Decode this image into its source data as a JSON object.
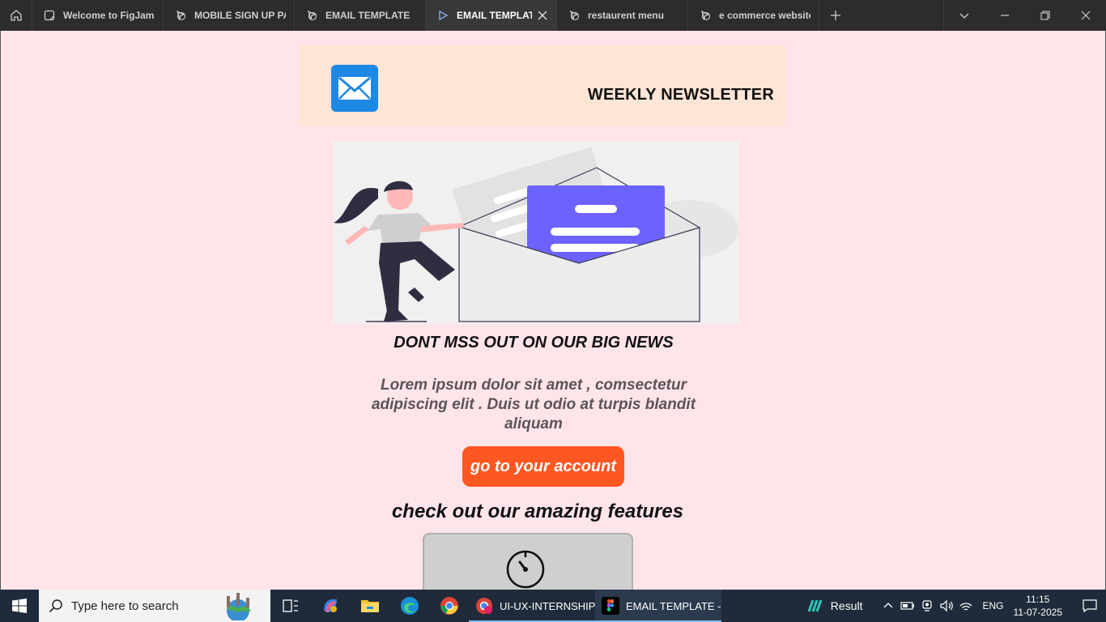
{
  "tabs": [
    {
      "label": "Welcome to FigJam",
      "icon": "figjam-icon"
    },
    {
      "label": "MOBILE SIGN UP PAGE",
      "icon": "figma-file-icon"
    },
    {
      "label": "EMAIL TEMPLATE",
      "icon": "figma-file-icon"
    },
    {
      "label": "EMAIL TEMPLATE",
      "icon": "prototype-play-icon",
      "active": true
    },
    {
      "label": "restaurent menu",
      "icon": "figma-file-icon"
    },
    {
      "label": "e commerce website ui",
      "icon": "figma-file-icon"
    }
  ],
  "email": {
    "header_title": "WEEKLY NEWSLETTER",
    "headline": "DONT MSS OUT ON  OUR BIG NEWS",
    "body": "Lorem ipsum dolor sit amet , comsectetur adipiscing elit . Duis ut odio at turpis blandit aliquam",
    "cta_label": "go to your account",
    "features_title": "check out our amazing features"
  },
  "taskbar": {
    "search_placeholder": "Type here to search",
    "apps": [
      {
        "label": "UI-UX-INTERNSHIP...",
        "icon": "chrome-profile-icon"
      },
      {
        "label": "EMAIL TEMPLATE - ...",
        "icon": "figma-icon",
        "active": true
      }
    ],
    "weather_label": "Result",
    "language": "ENG",
    "time": "11:15",
    "date": "11-07-2025"
  },
  "colors": {
    "page_bg": "#ffe4ea",
    "header_band": "#ffe5d5",
    "cta": "#ff5722",
    "envelope_letter": "#6c63ff",
    "mail_icon_bg": "#1e88e5"
  }
}
